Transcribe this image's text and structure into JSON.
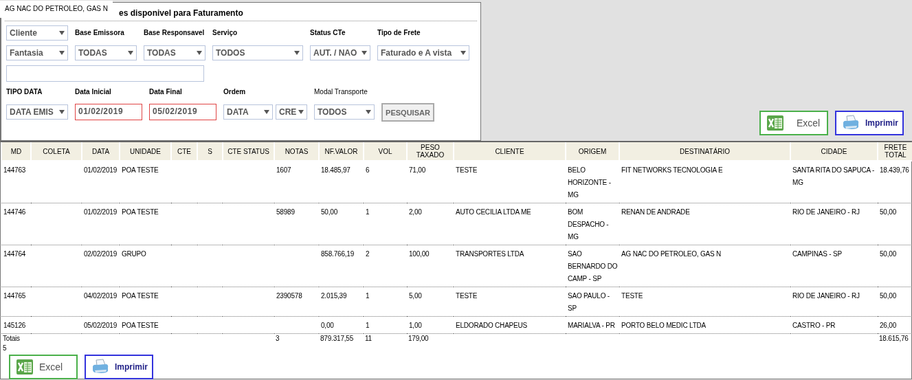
{
  "filter_panel": {
    "tooltip": "AG NAC DO PETROLEO, GAS N",
    "title": "es disponivel para Faturamento",
    "search_by": {
      "value": "Cliente"
    },
    "search_field": {
      "value": "Fantasia"
    },
    "top_fields": [
      {
        "label": "Base Emissora",
        "value": "TODAS"
      },
      {
        "label": "Base Responsavel",
        "value": "TODAS"
      },
      {
        "label": "Serviço",
        "value": "TODOS"
      },
      {
        "label": "Status CTe",
        "value": "AUT. / NAO"
      },
      {
        "label": "Tipo de Frete",
        "value": "Faturado e A vista"
      }
    ],
    "bottom_fields": [
      {
        "label": "TIPO DATA",
        "kind": "select",
        "values": [
          "DATA EMIS"
        ]
      },
      {
        "label": "Data Inicial",
        "kind": "date",
        "values": [
          "01/02/2019"
        ],
        "invalid": true
      },
      {
        "label": "Data Final",
        "kind": "date",
        "values": [
          "05/02/2019"
        ],
        "invalid": true
      },
      {
        "label": "Ordem",
        "kind": "select",
        "values": [
          "DATA",
          "CRE"
        ]
      },
      {
        "label": "Modal Transporte",
        "kind": "select",
        "values": [
          "TODOS"
        ]
      }
    ],
    "search_button": "PESQUISAR"
  },
  "top_buttons": [
    {
      "kind": "excel",
      "label": "Excel"
    },
    {
      "kind": "print",
      "label": "Imprimir"
    }
  ],
  "table": {
    "columns": [
      "MD",
      "COLETA",
      "DATA",
      "UNIDADE",
      "CTE",
      "S",
      "CTE STATUS",
      "NOTAS",
      "NF.VALOR",
      "VOL",
      "PESO TAXADO",
      "CLIENTE",
      "ORIGEM",
      "DESTINATÁRIO",
      "CIDADE",
      "FRETE TOTAL"
    ],
    "rows": [
      [
        "144763",
        null,
        "01/02/2019",
        "POA TESTE",
        null,
        null,
        null,
        "1607",
        "18.485,97",
        "6",
        "71,00",
        "TESTE",
        "BELO HORIZONTE - MG",
        "FIT NETWORKS TECNOLOGIA E",
        "SANTA RITA DO SAPUCA - MG",
        "18.439,76"
      ],
      [
        "144746",
        null,
        "01/02/2019",
        "POA TESTE",
        null,
        null,
        null,
        "58989",
        "50,00",
        "1",
        "2,00",
        "AUTO CECILIA LTDA ME",
        "BOM DESPACHO - MG",
        "RENAN DE ANDRADE",
        "RIO DE JANEIRO - RJ",
        "50,00"
      ],
      [
        "144764",
        null,
        "02/02/2019",
        "GRUPO",
        null,
        null,
        null,
        null,
        "858.766,19",
        "2",
        "100,00",
        "TRANSPORTES LTDA",
        "SAO BERNARDO DO CAMP - SP",
        "AG NAC DO PETROLEO, GAS N",
        "CAMPINAS - SP",
        "50,00"
      ],
      [
        "144765",
        null,
        "04/02/2019",
        "POA TESTE",
        null,
        null,
        null,
        "2390578",
        "2.015,39",
        "1",
        "5,00",
        "TESTE",
        "SAO PAULO - SP",
        "TESTE",
        "RIO DE JANEIRO - RJ",
        "50,00"
      ],
      [
        "145126",
        null,
        "05/02/2019",
        "POA TESTE",
        null,
        null,
        null,
        null,
        "0,00",
        "1",
        "1,00",
        "ELDORADO CHAPEUS",
        "MARIALVA - PR",
        "PORTO BELO MEDIC LTDA",
        "CASTRO - PR",
        "26,00"
      ]
    ],
    "totals": {
      "label": "Totais",
      "count": "5",
      "notas": "3",
      "nf_valor": "879.317,55",
      "vol": "11",
      "peso": "179,00",
      "frete_total": "18.615,76"
    }
  },
  "bottom_buttons": [
    {
      "kind": "excel",
      "label": "Excel"
    },
    {
      "kind": "print",
      "label": "Imprimir"
    }
  ]
}
